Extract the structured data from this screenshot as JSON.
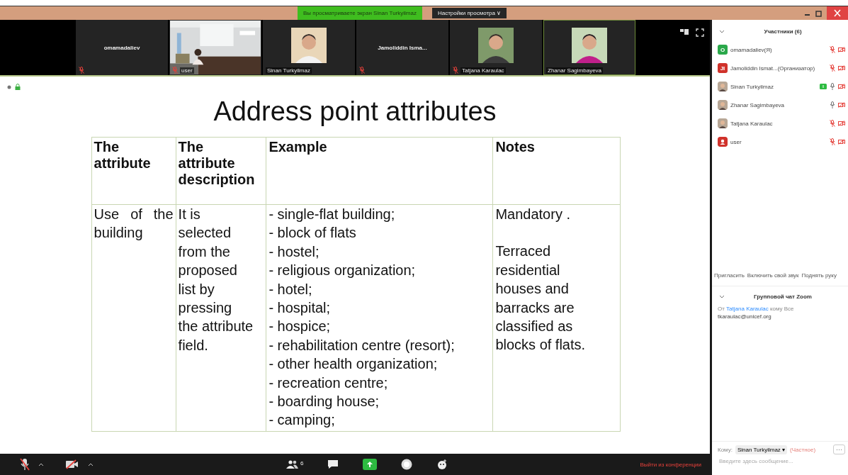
{
  "window": {
    "banner": "Вы просматриваете экран Sinan Turkyilmaz",
    "view_options": "Настройки просмотра ∨"
  },
  "tiles": [
    {
      "name": "omamadaliev",
      "kind": "name",
      "muted": true,
      "active": false
    },
    {
      "name": "user",
      "kind": "picture",
      "muted": true,
      "active": false
    },
    {
      "name": "Sinan Turkyilmaz",
      "muted": false,
      "active": false
    },
    {
      "name": "Jamoliddin Isma...",
      "kind": "name",
      "muted": true,
      "active": false
    },
    {
      "name": "Tatjana Karaulac",
      "muted": true,
      "active": false
    },
    {
      "name": "Zhanar Sagimbayeva",
      "muted": false,
      "active": true
    }
  ],
  "slide": {
    "title": "Address point attributes",
    "columns": [
      "The attribute",
      "The attribute description",
      "Example",
      "Notes"
    ],
    "row": {
      "attribute": "Use of the building",
      "description": "It is selected from the proposed list by pressing the attribute field.",
      "examples": [
        "- single-flat building;",
        "- block of flats",
        "- hostel;",
        "- religious organization;",
        "- hotel;",
        "- hospital;",
        "- hospice;",
        "- rehabilitation centre (resort);",
        "- other health organization;",
        "- recreation centre;",
        "- boarding house;",
        "- camping;"
      ],
      "notes": [
        "Mandatory .",
        "Terraced residential houses and barracks are classified as blocks of flats."
      ]
    }
  },
  "toolbar": {
    "participants_count": "6",
    "leave": "Выйти из конференции"
  },
  "panel": {
    "title": "Участники (6)",
    "participants": [
      {
        "name": "omamadaliev",
        "role": "(Я)",
        "kind": "letter",
        "letter": "O",
        "color": "#2aa84a",
        "sharing": false,
        "muted": true
      },
      {
        "name": "Jamoliddin Ismat...",
        "role": "(Организатор)",
        "kind": "letter",
        "letter": "JI",
        "color": "#d0322b",
        "sharing": false,
        "muted": true
      },
      {
        "name": "Sinan Turkyilmaz",
        "sharing": true,
        "muted": false
      },
      {
        "name": "Zhanar Sagimbayeva",
        "sharing": false,
        "muted": false
      },
      {
        "name": "Tatjana Karaulac",
        "sharing": false,
        "muted": true
      },
      {
        "name": "user",
        "kind": "icon",
        "color": "#d0322b",
        "sharing": false,
        "muted": true
      }
    ],
    "buttons": [
      "Пригласить",
      "Включить свой звук",
      "Поднять руку"
    ],
    "chat_title": "Групповой чат Zoom",
    "message": {
      "prefix": "От",
      "sender": "Tatjana Karaulac",
      "suffix": "кому Все",
      "text": "tkaraulac@unicef.org"
    },
    "to_label": "Кому:",
    "recipient": "Sinan Turkyilmaz ▾",
    "private": "(Частное)",
    "more": "···",
    "placeholder": "Введите здесь сообщение..."
  }
}
